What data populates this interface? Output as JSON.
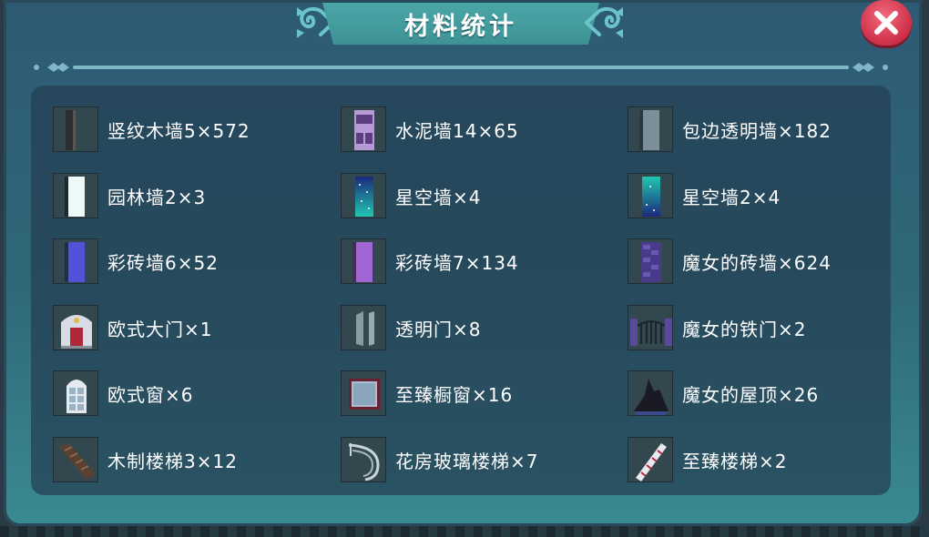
{
  "title": "材料统计",
  "close_icon": "close-x-icon",
  "colors": {
    "panel_top": "#2e5a74",
    "panel_bottom": "#3a8b92",
    "banner": "#4aa6a7",
    "close_button": "#d0334b"
  },
  "materials": [
    {
      "label": "竖纹木墙5×572",
      "icon": "vertical-wood-wall-icon"
    },
    {
      "label": "水泥墙14×65",
      "icon": "cement-wall-icon"
    },
    {
      "label": "包边透明墙×182",
      "icon": "edged-glass-wall-icon"
    },
    {
      "label": "园林墙2×3",
      "icon": "garden-wall-icon"
    },
    {
      "label": "星空墙×4",
      "icon": "starry-wall-icon"
    },
    {
      "label": "星空墙2×4",
      "icon": "starry-wall-2-icon"
    },
    {
      "label": "彩砖墙6×52",
      "icon": "color-brick-wall-6-icon"
    },
    {
      "label": "彩砖墙7×134",
      "icon": "color-brick-wall-7-icon"
    },
    {
      "label": "魔女的砖墙×624",
      "icon": "witch-brick-wall-icon"
    },
    {
      "label": "欧式大门×1",
      "icon": "european-gate-icon"
    },
    {
      "label": "透明门×8",
      "icon": "glass-door-icon"
    },
    {
      "label": "魔女的铁门×2",
      "icon": "witch-iron-gate-icon"
    },
    {
      "label": "欧式窗×6",
      "icon": "european-window-icon"
    },
    {
      "label": "至臻橱窗×16",
      "icon": "premium-display-window-icon"
    },
    {
      "label": "魔女的屋顶×26",
      "icon": "witch-roof-icon"
    },
    {
      "label": "木制楼梯3×12",
      "icon": "wooden-stairs-icon"
    },
    {
      "label": "花房玻璃楼梯×7",
      "icon": "greenhouse-glass-stairs-icon"
    },
    {
      "label": "至臻楼梯×2",
      "icon": "premium-stairs-icon"
    }
  ]
}
